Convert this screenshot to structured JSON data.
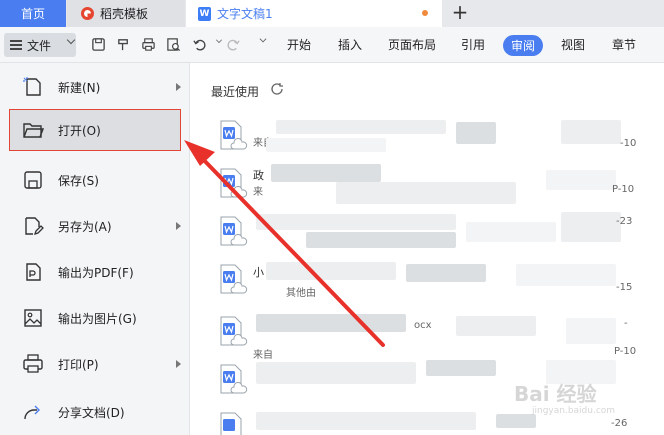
{
  "tabs": [
    {
      "label": "首页"
    },
    {
      "label": "稻壳模板"
    },
    {
      "label": "文字文稿1"
    }
  ],
  "toolbar": {
    "file_label": "文件",
    "menu_tabs": [
      "开始",
      "插入",
      "页面布局",
      "引用",
      "审阅",
      "视图",
      "章节"
    ],
    "active_tab": "审阅"
  },
  "file_menu": {
    "items": [
      {
        "label": "新建(N)",
        "icon": "new-document-icon",
        "submenu": true
      },
      {
        "label": "打开(O)",
        "icon": "folder-open-icon",
        "submenu": false,
        "selected": true
      },
      {
        "label": "保存(S)",
        "icon": "save-icon",
        "submenu": false
      },
      {
        "label": "另存为(A)",
        "icon": "save-as-icon",
        "submenu": true
      },
      {
        "label": "输出为PDF(F)",
        "icon": "export-pdf-icon",
        "submenu": false
      },
      {
        "label": "输出为图片(G)",
        "icon": "export-image-icon",
        "submenu": false
      },
      {
        "label": "打印(P)",
        "icon": "printer-icon",
        "submenu": true
      },
      {
        "label": "分享文档(D)",
        "icon": "share-icon",
        "submenu": false
      }
    ]
  },
  "recent": {
    "title": "最近使用",
    "fragments": {
      "r1": "来自",
      "r1_right": "-10",
      "r2": "政",
      "r2_b": "来",
      "r2_right": "P-10",
      "r3_right": "-23",
      "r4": "小",
      "r4_b": "其他由",
      "r4_right": "-15",
      "r5_mid": "ocx",
      "r5_right": "-",
      "r6": "来自",
      "r6_right": "P-10",
      "r7_right": "-26"
    }
  },
  "watermark": {
    "text": "Bai  经验",
    "sub": "jingyan.baidu.com"
  },
  "colors": {
    "accent": "#4a7ef0",
    "highlight": "#e04535",
    "arrow": "#e8312a"
  }
}
